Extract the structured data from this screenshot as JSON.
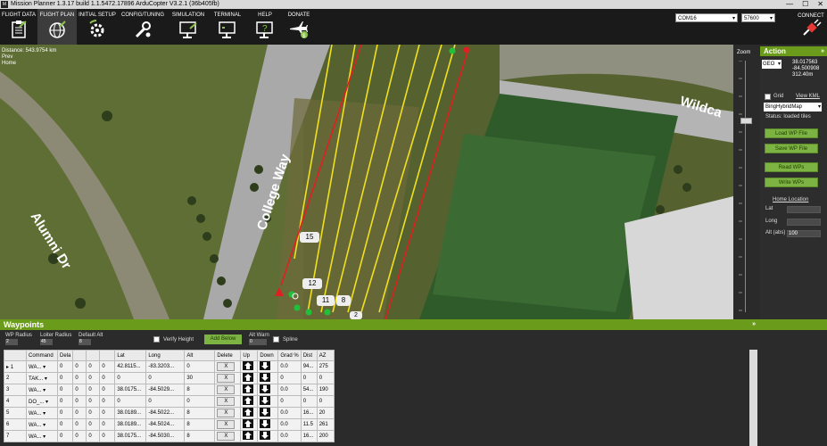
{
  "window": {
    "title": "Mission Planner 1.3.17 build 1.1.5472.17896 ArduCopter V3.2.1 (36b405fb)",
    "logo_text": "M",
    "min": "—",
    "max": "☐",
    "close": "✕"
  },
  "nav": {
    "tabs": [
      {
        "label": "FLIGHT DATA",
        "icon": "clipboard-icon"
      },
      {
        "label": "FLIGHT PLAN",
        "icon": "globe-icon"
      },
      {
        "label": "INITIAL SETUP",
        "icon": "setup-gear-icon"
      },
      {
        "label": "CONFIG/TUNING",
        "icon": "wrench-icon"
      },
      {
        "label": "SIMULATION",
        "icon": "monitor-icon"
      },
      {
        "label": "TERMINAL",
        "icon": "terminal-icon"
      },
      {
        "label": "HELP",
        "icon": "help-monitor-icon"
      },
      {
        "label": "DONATE",
        "icon": "plane-dollar-icon"
      }
    ],
    "com_port": "COM16",
    "baud": "57600",
    "connect_label": "CONNECT"
  },
  "map": {
    "distance": "Distance: 543.9754 km",
    "prev": "Prev",
    "home": "Home",
    "labels": {
      "road1": "College Way",
      "road2": "Alumni Dr",
      "road3": "Wildca"
    },
    "markers": [
      "15",
      "12",
      "11",
      "8",
      "2"
    ],
    "zoom_label": "Zoom"
  },
  "action": {
    "header": "Action",
    "collapse": "»",
    "coord_mode": "GEO",
    "lat": "38.017563",
    "lng": "-84.500908",
    "alt": "312.40m",
    "grid_label": "Grid",
    "view_kml": "View KML",
    "map_type": "BingHybridMap",
    "status": "Status: loaded tiles",
    "buttons": {
      "load_wp": "Load WP File",
      "save_wp": "Save WP File",
      "read_wps": "Read WPs",
      "write_wps": "Write WPs"
    },
    "home_location": "Home Location",
    "home_lat": "Lat",
    "home_long": "Long",
    "home_alt": "Alt (abs)",
    "home_alt_value": "100"
  },
  "waypoints": {
    "header": "Waypoints",
    "collapse": "»",
    "wp_radius_label": "WP Radius",
    "wp_radius": "2",
    "loiter_radius_label": "Loiter Radius",
    "loiter_radius": "45",
    "default_alt_label": "Default Alt",
    "default_alt": "8",
    "verify_height": "Verify Height",
    "add_below": "Add Below",
    "alt_warn_label": "Alt Warn",
    "alt_warn": "0",
    "spline": "Spline",
    "columns": [
      "",
      "Command",
      "Dela",
      "",
      "",
      "",
      "Lat",
      "Long",
      "Alt",
      "Delete",
      "Up",
      "Down",
      "Grad %",
      "Dist",
      "AZ"
    ],
    "rows": [
      {
        "n": "1",
        "cmd": "WA...",
        "d1": "0",
        "d2": "0",
        "d3": "0",
        "d4": "0",
        "lat": "42.8115...",
        "lng": "-83.3203...",
        "alt": "0",
        "grad": "0.0",
        "dist": "94...",
        "az": "275"
      },
      {
        "n": "2",
        "cmd": "TAK...",
        "d1": "0",
        "d2": "0",
        "d3": "0",
        "d4": "0",
        "lat": "0",
        "lng": "0",
        "alt": "30",
        "grad": "0",
        "dist": "0",
        "az": "0"
      },
      {
        "n": "3",
        "cmd": "WA...",
        "d1": "0",
        "d2": "0",
        "d3": "0",
        "d4": "0",
        "lat": "38.0175...",
        "lng": "-84.5029...",
        "alt": "8",
        "grad": "0.0",
        "dist": "54...",
        "az": "190"
      },
      {
        "n": "4",
        "cmd": "DO_...",
        "d1": "0",
        "d2": "0",
        "d3": "0",
        "d4": "0",
        "lat": "0",
        "lng": "0",
        "alt": "0",
        "grad": "0",
        "dist": "0",
        "az": "0"
      },
      {
        "n": "5",
        "cmd": "WA...",
        "d1": "0",
        "d2": "0",
        "d3": "0",
        "d4": "0",
        "lat": "38.0189...",
        "lng": "-84.5022...",
        "alt": "8",
        "grad": "0.0",
        "dist": "16...",
        "az": "20"
      },
      {
        "n": "6",
        "cmd": "WA...",
        "d1": "0",
        "d2": "0",
        "d3": "0",
        "d4": "0",
        "lat": "38.0189...",
        "lng": "-84.5024...",
        "alt": "8",
        "grad": "0.0",
        "dist": "11.5",
        "az": "261"
      },
      {
        "n": "7",
        "cmd": "WA...",
        "d1": "0",
        "d2": "0",
        "d3": "0",
        "d4": "0",
        "lat": "38.0175...",
        "lng": "-84.5030...",
        "alt": "8",
        "grad": "0.0",
        "dist": "16...",
        "az": "200"
      }
    ],
    "delete_label": "X"
  },
  "colors": {
    "accent": "#6a9b1a",
    "button": "#7cb342",
    "path_yellow": "#f0e020",
    "path_red": "#e02020"
  }
}
